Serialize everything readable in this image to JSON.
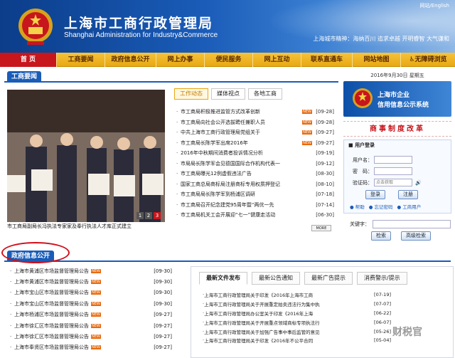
{
  "header": {
    "title": "上海市工商行政管理局",
    "subtitle": "Shanghai Administration for Industry&Commerce",
    "lang": "网站/English",
    "spirit": "上海城市精神：海纳百川 追求卓越 开明睿智 大气谦和"
  },
  "nav": [
    "首 页",
    "工商要闻",
    "政府信息公开",
    "网上办事",
    "便民服务",
    "网上互动",
    "联系直通车",
    "网站地图",
    "无障碍浏览"
  ],
  "news": {
    "section_label": "工商要闻",
    "tabs": [
      "工作动态",
      "媒体视点",
      "各地工商"
    ],
    "caption": "市工商局副局长冯执法专家家及奉行执法人才库正式建立",
    "pager": [
      "1",
      "2",
      "3"
    ],
    "more": "MORE",
    "items": [
      {
        "title": "市工商局积极推进监管方式改革创新",
        "date": "[09-28]",
        "new": true
      },
      {
        "title": "市工商局向社会公开选拔聘任兼职人员",
        "date": "[09-28]",
        "new": true
      },
      {
        "title": "中共上海市工商行政管理局党组关于",
        "date": "[09-27]",
        "new": true
      },
      {
        "title": "市工商局长陈学军出席2016年",
        "date": "[09-27]",
        "new": true
      },
      {
        "title": "2016年中秋期间消费者投诉情况分析",
        "date": "[09-19]",
        "new": false
      },
      {
        "title": "市局局长陈学军会见德国国际合作机构代表一",
        "date": "[09-12]",
        "new": false
      },
      {
        "title": "市工商局曝光12例虚假违法广告",
        "date": "[08-30]",
        "new": false
      },
      {
        "title": "国家工商总局商标局注册商标专用权质押登记",
        "date": "[08-10]",
        "new": false
      },
      {
        "title": "市工商局局长陈学军到杨浦区调研",
        "date": "[07-18]",
        "new": false
      },
      {
        "title": "市工商局召开纪念建党95周年暨“两优一先",
        "date": "[07-14]",
        "new": false
      },
      {
        "title": "市工商局机关工会开展迎“七一”健康走活动",
        "date": "[06-30]",
        "new": false
      }
    ]
  },
  "right": {
    "date": "2016年9月30日 星期五",
    "credit_line1": "上海市企业",
    "credit_line2": "信用信息公示系统",
    "reform": "商事制度改革",
    "login_title": "用户登录",
    "username_label": "用户名：",
    "password_label": "密　码：",
    "captcha_label": "验证码：",
    "captcha_placeholder": "点击获取",
    "login_btn": "登录",
    "register_btn": "注册",
    "help": "帮助",
    "forgot": "忘记密码",
    "user_guide": "工商用户",
    "keyword_label": "关键字：",
    "search_btn": "检索",
    "advanced_btn": "高级检索"
  },
  "gov": {
    "section_label": "政府信息公开",
    "items": [
      {
        "title": "上海市黄浦区市场监督管理局公告",
        "date": "[09-30]"
      },
      {
        "title": "上海市黄浦区市场监督管理局公告",
        "date": "[09-30]"
      },
      {
        "title": "上海市宝山区市场监督管理局公告",
        "date": "[09-30]"
      },
      {
        "title": "上海市宝山区市场监督管理局公告",
        "date": "[09-30]"
      },
      {
        "title": "上海市杨浦区市场监督管理局公告",
        "date": "[09-27]"
      },
      {
        "title": "上海市徐汇区市场监督管理局公告",
        "date": "[09-27]"
      },
      {
        "title": "上海市徐汇区市场监督管理局公告",
        "date": "[09-27]"
      },
      {
        "title": "上海市奉贤区市场监督管理局公告",
        "date": "[09-27]"
      }
    ]
  },
  "files": {
    "tabs": [
      "最新文件发布",
      "最新公告通知",
      "最新广告提示",
      "消费警示/提示"
    ],
    "items": [
      {
        "title": "上海市工商行政管理局关于印发《2016年上海市工商",
        "date": "[07-19]"
      },
      {
        "title": "上海市工商行政管理局关于开展重定拍卖违法行为集中执",
        "date": "[07-07]"
      },
      {
        "title": "上海市工商行政管理局办公室关于印发《2016年上海",
        "date": "[06-22]"
      },
      {
        "title": "上海市工商行政管理局关于开展重点领域商标专项执法行",
        "date": "[06-07]"
      },
      {
        "title": "上海市工商行政管理局关于加强广告事中事后监管的意见",
        "date": "[05-26]"
      },
      {
        "title": "上海市工商行政管理局关于印发《2016年不公平合同",
        "date": "[05-04]"
      }
    ]
  },
  "watermark": "财税官",
  "colors": {
    "brand_blue": "#1a5cb8",
    "nav_gold": "#e8a812",
    "accent_red": "#c8161d"
  }
}
